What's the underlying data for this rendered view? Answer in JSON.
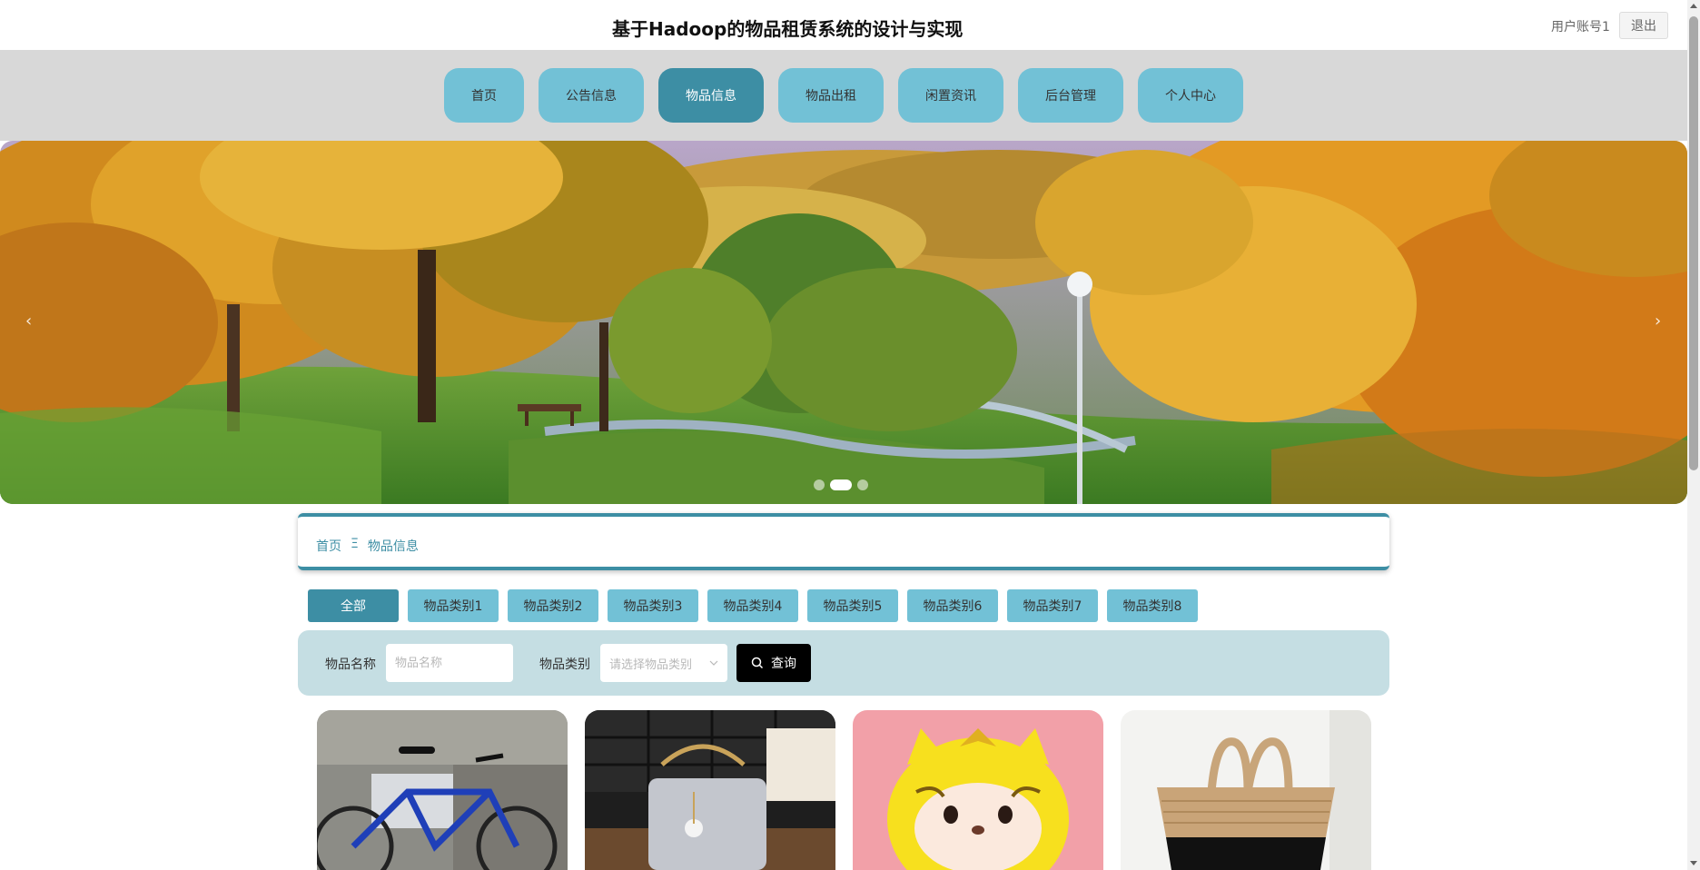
{
  "header": {
    "title": "基于Hadoop的物品租赁系统的设计与实现",
    "user_account": "用户账号1",
    "logout_label": "退出"
  },
  "nav": {
    "items": [
      {
        "label": "首页"
      },
      {
        "label": "公告信息"
      },
      {
        "label": "物品信息",
        "active": true
      },
      {
        "label": "物品出租"
      },
      {
        "label": "闲置资讯"
      },
      {
        "label": "后台管理"
      },
      {
        "label": "个人中心"
      }
    ]
  },
  "carousel": {
    "slide_count": 3,
    "active_index": 1,
    "prev_icon": "chevron-left-icon",
    "next_icon": "chevron-right-icon"
  },
  "breadcrumb": {
    "home": "首页",
    "separator": "Ξ",
    "current": "物品信息"
  },
  "categories": [
    {
      "label": "全部",
      "active": true
    },
    {
      "label": "物品类别1"
    },
    {
      "label": "物品类别2"
    },
    {
      "label": "物品类别3"
    },
    {
      "label": "物品类别4"
    },
    {
      "label": "物品类别5"
    },
    {
      "label": "物品类别6"
    },
    {
      "label": "物品类别7"
    },
    {
      "label": "物品类别8"
    }
  ],
  "search": {
    "name_label": "物品名称",
    "name_placeholder": "物品名称",
    "name_value": "",
    "category_label": "物品类别",
    "category_placeholder": "请选择物品类别",
    "button_label": "查询",
    "button_icon": "search-icon"
  },
  "colors": {
    "nav_bg": "#72c1d6",
    "nav_active": "#3d8ea4",
    "search_bg": "#c5dee3",
    "header_band": "#d8d8d8"
  }
}
